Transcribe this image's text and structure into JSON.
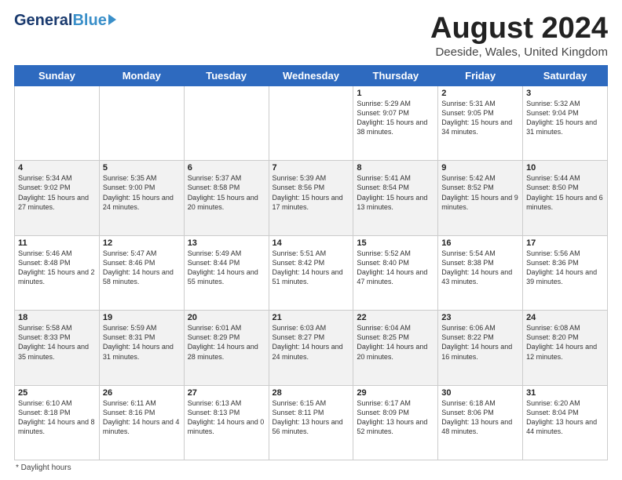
{
  "logo": {
    "general": "General",
    "blue": "Blue"
  },
  "header": {
    "title": "August 2024",
    "location": "Deeside, Wales, United Kingdom"
  },
  "days_of_week": [
    "Sunday",
    "Monday",
    "Tuesday",
    "Wednesday",
    "Thursday",
    "Friday",
    "Saturday"
  ],
  "footer": {
    "daylight_label": "Daylight hours"
  },
  "weeks": [
    {
      "row_class": "row-white",
      "days": [
        {
          "number": "",
          "sunrise": "",
          "sunset": "",
          "daylight": ""
        },
        {
          "number": "",
          "sunrise": "",
          "sunset": "",
          "daylight": ""
        },
        {
          "number": "",
          "sunrise": "",
          "sunset": "",
          "daylight": ""
        },
        {
          "number": "",
          "sunrise": "",
          "sunset": "",
          "daylight": ""
        },
        {
          "number": "1",
          "sunrise": "Sunrise: 5:29 AM",
          "sunset": "Sunset: 9:07 PM",
          "daylight": "Daylight: 15 hours and 38 minutes."
        },
        {
          "number": "2",
          "sunrise": "Sunrise: 5:31 AM",
          "sunset": "Sunset: 9:05 PM",
          "daylight": "Daylight: 15 hours and 34 minutes."
        },
        {
          "number": "3",
          "sunrise": "Sunrise: 5:32 AM",
          "sunset": "Sunset: 9:04 PM",
          "daylight": "Daylight: 15 hours and 31 minutes."
        }
      ]
    },
    {
      "row_class": "row-gray",
      "days": [
        {
          "number": "4",
          "sunrise": "Sunrise: 5:34 AM",
          "sunset": "Sunset: 9:02 PM",
          "daylight": "Daylight: 15 hours and 27 minutes."
        },
        {
          "number": "5",
          "sunrise": "Sunrise: 5:35 AM",
          "sunset": "Sunset: 9:00 PM",
          "daylight": "Daylight: 15 hours and 24 minutes."
        },
        {
          "number": "6",
          "sunrise": "Sunrise: 5:37 AM",
          "sunset": "Sunset: 8:58 PM",
          "daylight": "Daylight: 15 hours and 20 minutes."
        },
        {
          "number": "7",
          "sunrise": "Sunrise: 5:39 AM",
          "sunset": "Sunset: 8:56 PM",
          "daylight": "Daylight: 15 hours and 17 minutes."
        },
        {
          "number": "8",
          "sunrise": "Sunrise: 5:41 AM",
          "sunset": "Sunset: 8:54 PM",
          "daylight": "Daylight: 15 hours and 13 minutes."
        },
        {
          "number": "9",
          "sunrise": "Sunrise: 5:42 AM",
          "sunset": "Sunset: 8:52 PM",
          "daylight": "Daylight: 15 hours and 9 minutes."
        },
        {
          "number": "10",
          "sunrise": "Sunrise: 5:44 AM",
          "sunset": "Sunset: 8:50 PM",
          "daylight": "Daylight: 15 hours and 6 minutes."
        }
      ]
    },
    {
      "row_class": "row-white",
      "days": [
        {
          "number": "11",
          "sunrise": "Sunrise: 5:46 AM",
          "sunset": "Sunset: 8:48 PM",
          "daylight": "Daylight: 15 hours and 2 minutes."
        },
        {
          "number": "12",
          "sunrise": "Sunrise: 5:47 AM",
          "sunset": "Sunset: 8:46 PM",
          "daylight": "Daylight: 14 hours and 58 minutes."
        },
        {
          "number": "13",
          "sunrise": "Sunrise: 5:49 AM",
          "sunset": "Sunset: 8:44 PM",
          "daylight": "Daylight: 14 hours and 55 minutes."
        },
        {
          "number": "14",
          "sunrise": "Sunrise: 5:51 AM",
          "sunset": "Sunset: 8:42 PM",
          "daylight": "Daylight: 14 hours and 51 minutes."
        },
        {
          "number": "15",
          "sunrise": "Sunrise: 5:52 AM",
          "sunset": "Sunset: 8:40 PM",
          "daylight": "Daylight: 14 hours and 47 minutes."
        },
        {
          "number": "16",
          "sunrise": "Sunrise: 5:54 AM",
          "sunset": "Sunset: 8:38 PM",
          "daylight": "Daylight: 14 hours and 43 minutes."
        },
        {
          "number": "17",
          "sunrise": "Sunrise: 5:56 AM",
          "sunset": "Sunset: 8:36 PM",
          "daylight": "Daylight: 14 hours and 39 minutes."
        }
      ]
    },
    {
      "row_class": "row-gray",
      "days": [
        {
          "number": "18",
          "sunrise": "Sunrise: 5:58 AM",
          "sunset": "Sunset: 8:33 PM",
          "daylight": "Daylight: 14 hours and 35 minutes."
        },
        {
          "number": "19",
          "sunrise": "Sunrise: 5:59 AM",
          "sunset": "Sunset: 8:31 PM",
          "daylight": "Daylight: 14 hours and 31 minutes."
        },
        {
          "number": "20",
          "sunrise": "Sunrise: 6:01 AM",
          "sunset": "Sunset: 8:29 PM",
          "daylight": "Daylight: 14 hours and 28 minutes."
        },
        {
          "number": "21",
          "sunrise": "Sunrise: 6:03 AM",
          "sunset": "Sunset: 8:27 PM",
          "daylight": "Daylight: 14 hours and 24 minutes."
        },
        {
          "number": "22",
          "sunrise": "Sunrise: 6:04 AM",
          "sunset": "Sunset: 8:25 PM",
          "daylight": "Daylight: 14 hours and 20 minutes."
        },
        {
          "number": "23",
          "sunrise": "Sunrise: 6:06 AM",
          "sunset": "Sunset: 8:22 PM",
          "daylight": "Daylight: 14 hours and 16 minutes."
        },
        {
          "number": "24",
          "sunrise": "Sunrise: 6:08 AM",
          "sunset": "Sunset: 8:20 PM",
          "daylight": "Daylight: 14 hours and 12 minutes."
        }
      ]
    },
    {
      "row_class": "row-white",
      "days": [
        {
          "number": "25",
          "sunrise": "Sunrise: 6:10 AM",
          "sunset": "Sunset: 8:18 PM",
          "daylight": "Daylight: 14 hours and 8 minutes."
        },
        {
          "number": "26",
          "sunrise": "Sunrise: 6:11 AM",
          "sunset": "Sunset: 8:16 PM",
          "daylight": "Daylight: 14 hours and 4 minutes."
        },
        {
          "number": "27",
          "sunrise": "Sunrise: 6:13 AM",
          "sunset": "Sunset: 8:13 PM",
          "daylight": "Daylight: 14 hours and 0 minutes."
        },
        {
          "number": "28",
          "sunrise": "Sunrise: 6:15 AM",
          "sunset": "Sunset: 8:11 PM",
          "daylight": "Daylight: 13 hours and 56 minutes."
        },
        {
          "number": "29",
          "sunrise": "Sunrise: 6:17 AM",
          "sunset": "Sunset: 8:09 PM",
          "daylight": "Daylight: 13 hours and 52 minutes."
        },
        {
          "number": "30",
          "sunrise": "Sunrise: 6:18 AM",
          "sunset": "Sunset: 8:06 PM",
          "daylight": "Daylight: 13 hours and 48 minutes."
        },
        {
          "number": "31",
          "sunrise": "Sunrise: 6:20 AM",
          "sunset": "Sunset: 8:04 PM",
          "daylight": "Daylight: 13 hours and 44 minutes."
        }
      ]
    }
  ]
}
